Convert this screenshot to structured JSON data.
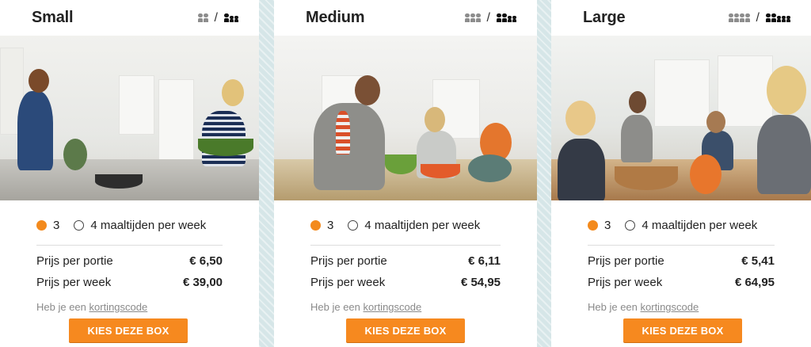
{
  "plans": [
    {
      "name": "Small",
      "person_icons": {
        "adults": "two-adults-icon",
        "family": "family-icon"
      },
      "photo_alt": "",
      "option_selected": "3",
      "option_other": "4 maaltijden per week",
      "price_portion_label": "Prijs per portie",
      "price_portion": "€ 6,50",
      "price_week_label": "Prijs per week",
      "price_week": "€ 39,00",
      "coupon_prefix": "Heb je een",
      "coupon_link": "kortingscode",
      "cta": "KIES DEZE BOX"
    },
    {
      "name": "Medium",
      "person_icons": {
        "adults": "three-adults-icon",
        "family": "family-icon"
      },
      "photo_alt": "",
      "option_selected": "3",
      "option_other": "4 maaltijden per week",
      "price_portion_label": "Prijs per portie",
      "price_portion": "€ 6,11",
      "price_week_label": "Prijs per week",
      "price_week": "€ 54,95",
      "coupon_prefix": "Heb je een",
      "coupon_link": "kortingscode",
      "cta": "KIES DEZE BOX"
    },
    {
      "name": "Large",
      "person_icons": {
        "adults": "four-adults-icon",
        "family": "family-icon"
      },
      "photo_alt": "",
      "option_selected": "3",
      "option_other": "4 maaltijden per week",
      "price_portion_label": "Prijs per portie",
      "price_portion": "€ 5,41",
      "price_week_label": "Prijs per week",
      "price_week": "€ 64,95",
      "coupon_prefix": "Heb je een",
      "coupon_link": "kortingscode",
      "cta": "KIES DEZE BOX"
    }
  ],
  "slash": "/",
  "colors": {
    "accent": "#f6891f",
    "radio_on": "#f38a1d",
    "background": "#d6e6e8"
  }
}
